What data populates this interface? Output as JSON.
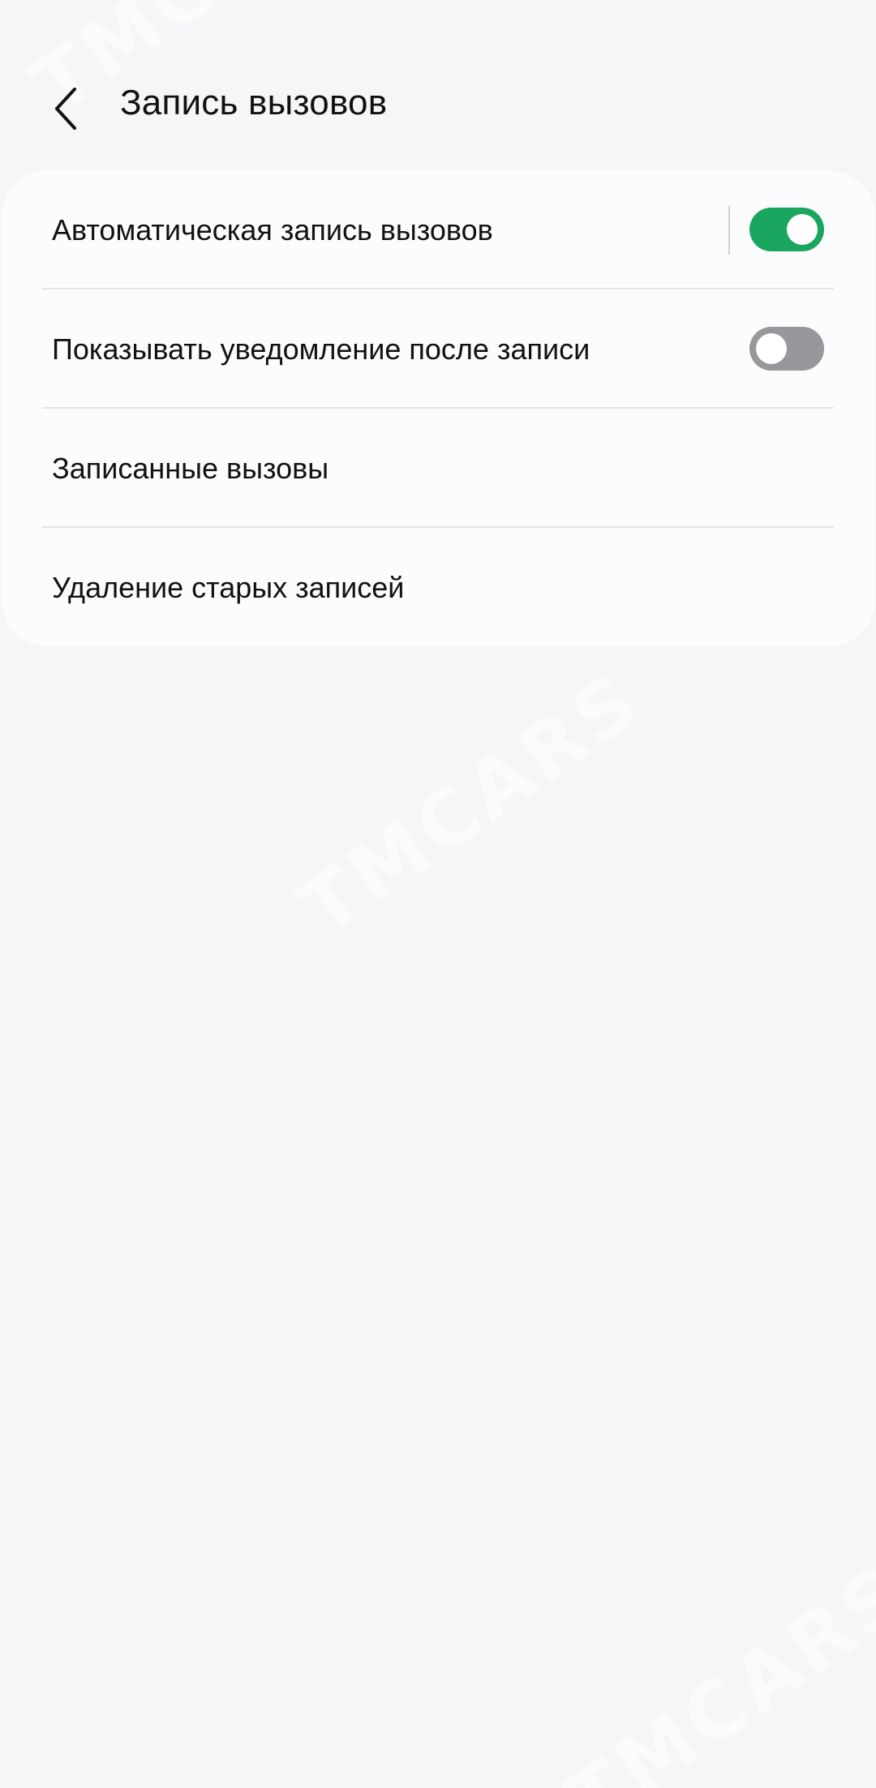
{
  "header": {
    "title": "Запись вызовов",
    "back_icon": "chevron-left-icon"
  },
  "settings": {
    "items": [
      {
        "label": "Автоматическая запись вызовов",
        "toggle": true,
        "enabled": true
      },
      {
        "label": "Показывать уведомление после записи",
        "toggle": true,
        "enabled": false
      },
      {
        "label": "Записанные вызовы",
        "toggle": false
      },
      {
        "label": "Удаление старых записей",
        "toggle": false
      }
    ]
  },
  "watermark": {
    "text": "TMCARS"
  },
  "colors": {
    "background": "#f6f6f8",
    "card": "#fcfcfe",
    "toggle_on": "#1aa65f",
    "toggle_off": "#97979c",
    "text": "#111111"
  }
}
